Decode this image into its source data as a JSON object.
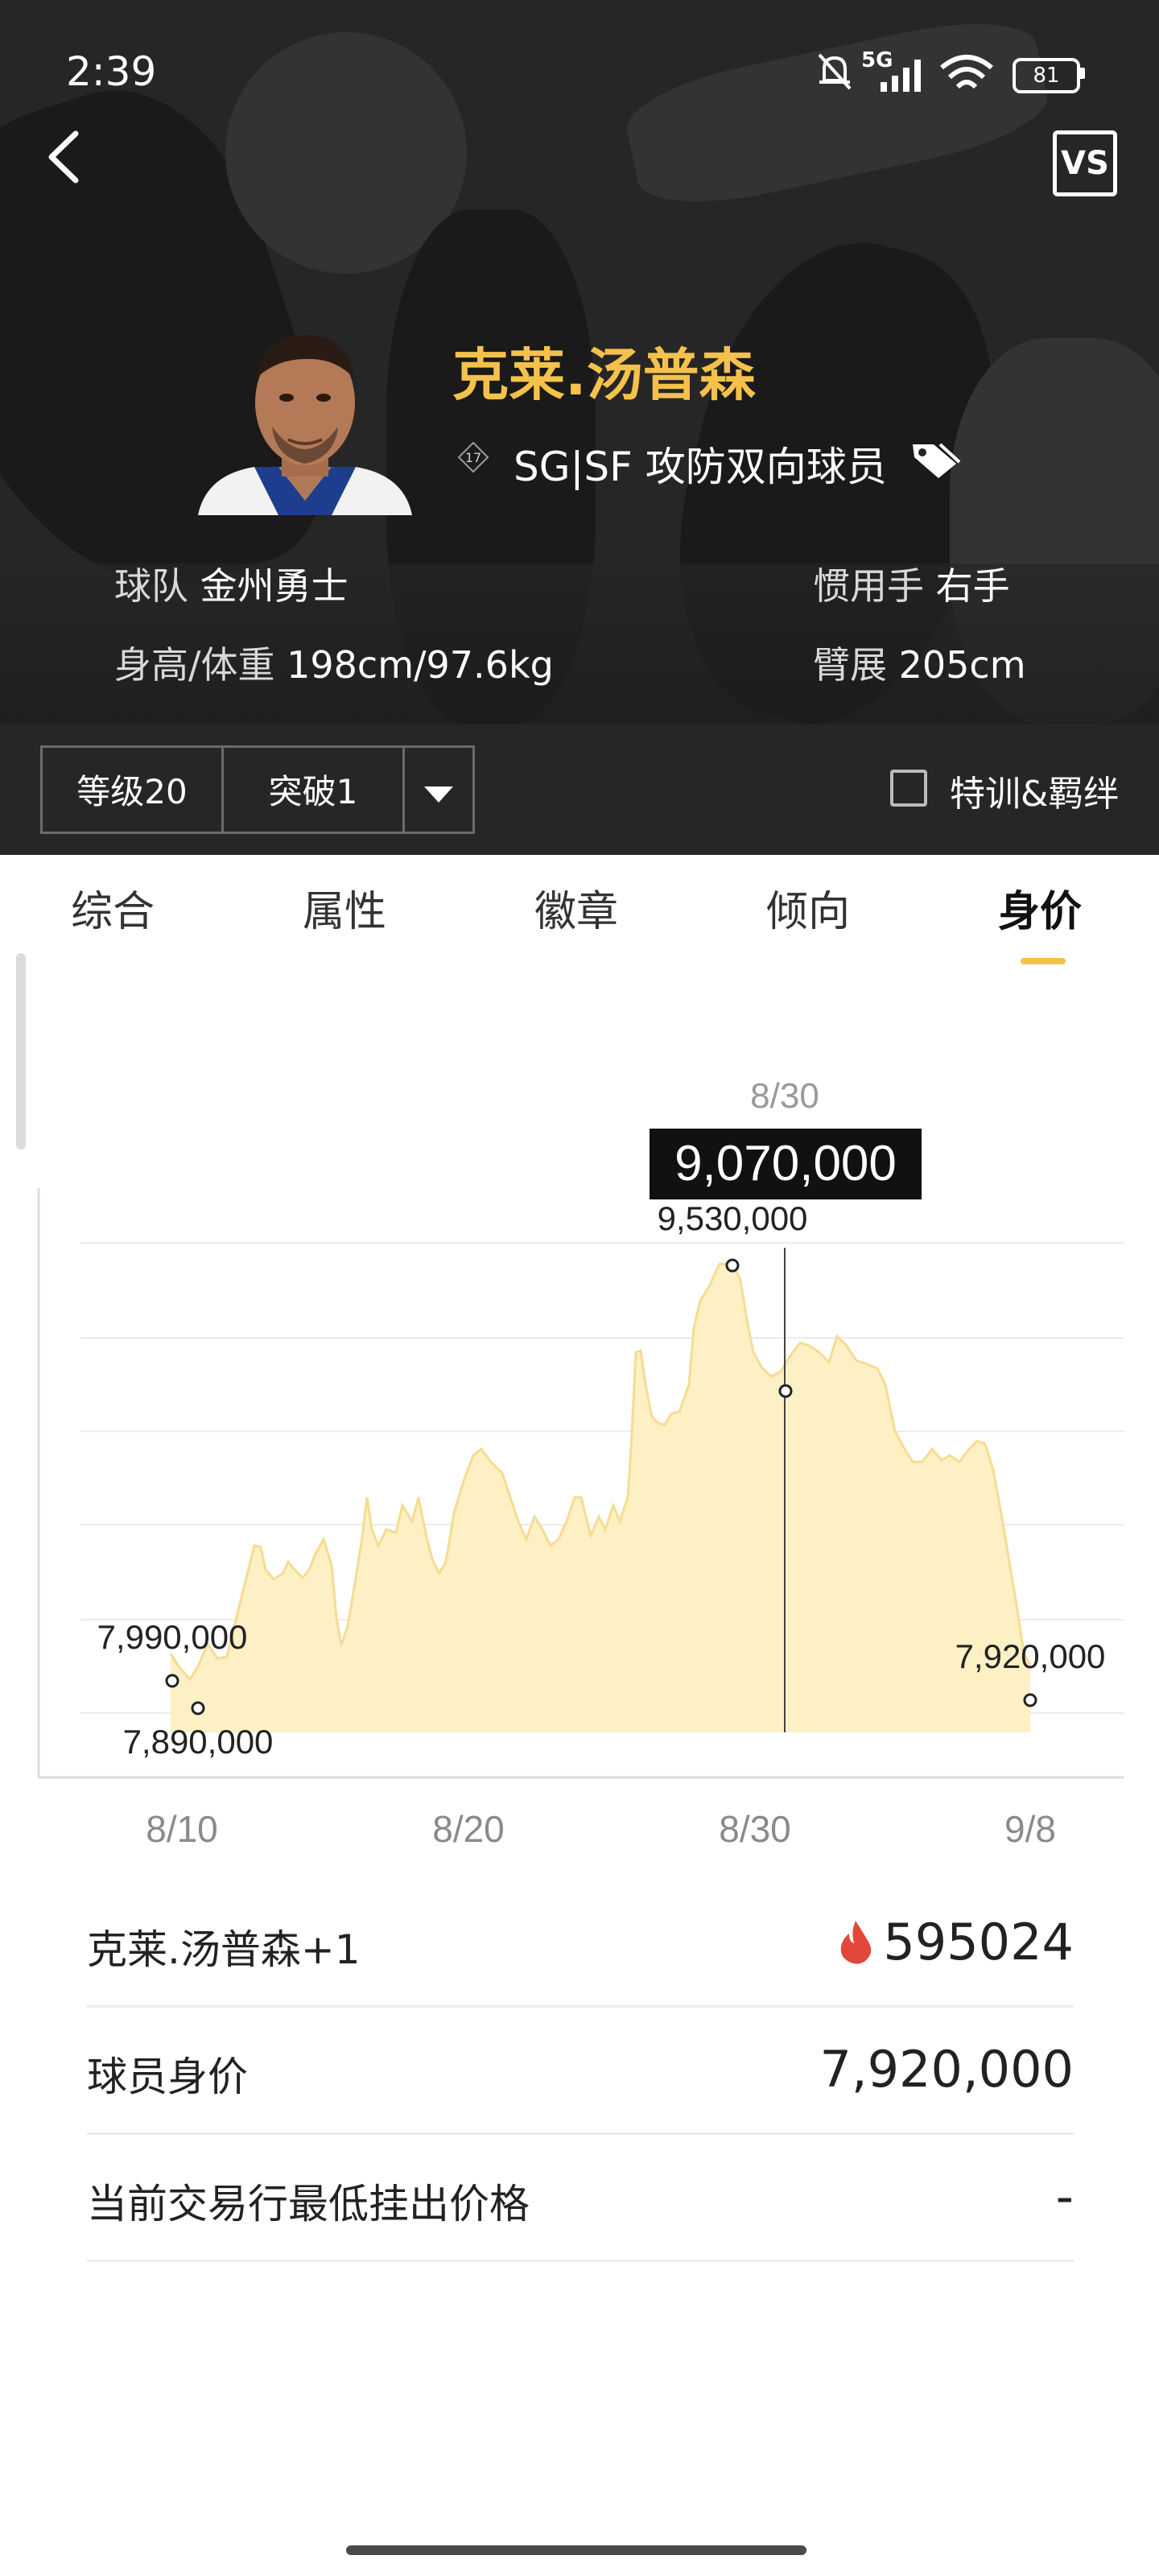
{
  "status_bar": {
    "time": "2:39",
    "network": "5G",
    "battery": "81"
  },
  "player": {
    "name": "克莱.汤普森",
    "rank_badge": "17",
    "position": "SG|SF 攻防双向球员",
    "team_label": "球队",
    "team": "金州勇士",
    "hand_label": "惯用手",
    "hand": "右手",
    "body_label": "身高/体重",
    "body": "198cm/97.6kg",
    "wingspan_label": "臂展",
    "wingspan": "205cm"
  },
  "level_bar": {
    "level": "等级20",
    "breakthrough": "突破1",
    "checkbox_label": "特训&羁绊"
  },
  "tabs": [
    "综合",
    "属性",
    "徽章",
    "倾向",
    "身价"
  ],
  "active_tab": "身价",
  "chart_data": {
    "type": "area",
    "x_ticks": [
      "8/10",
      "8/20",
      "8/30",
      "9/8"
    ],
    "crosshair_date": "8/30",
    "tooltip_value": "9,070,000",
    "annotations": [
      {
        "label": "7,990,000",
        "value": 7990000
      },
      {
        "label": "7,890,000",
        "value": 7890000
      },
      {
        "label": "9,530,000",
        "value": 9530000
      },
      {
        "label": "7,920,000",
        "value": 7920000
      }
    ],
    "fill_color": "#fdf0c4",
    "line_color": "#f6dc92",
    "grid": true
  },
  "rows": [
    {
      "label": "克莱.汤普森+1",
      "value": "595024",
      "icon": "flame-icon",
      "icon_color": "#e2483a"
    },
    {
      "label": "球员身价",
      "value": "7,920,000"
    },
    {
      "label": "当前交易行最低挂出价格",
      "value": "-"
    }
  ]
}
